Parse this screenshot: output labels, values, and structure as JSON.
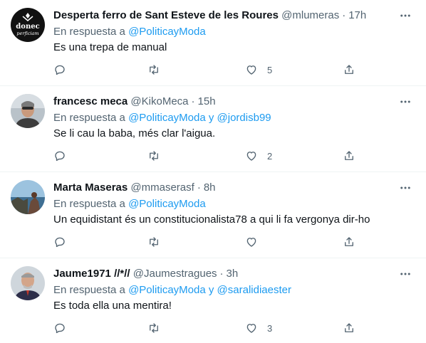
{
  "colors": {
    "text": "#0f1419",
    "secondary": "#536471",
    "link": "#1d9bf0",
    "divider": "#eff3f4"
  },
  "tweets": [
    {
      "name": "Desperta ferro de Sant Esteve de les Roures",
      "handle": "@mlumeras",
      "time": "17h",
      "reply_prefix": "En respuesta a",
      "mention1": "@PoliticayModa",
      "mention_joiner": "",
      "mention2": "",
      "text": "Es una trepa de manual",
      "like_count": "5",
      "avatar": {
        "top_text": "donec",
        "bottom_text": "perficiam"
      }
    },
    {
      "name": "francesc meca",
      "handle": "@KikoMeca",
      "time": "15h",
      "reply_prefix": "En respuesta a",
      "mention1": "@PoliticayModa",
      "mention_joiner": "y",
      "mention2": "@jordisb99",
      "text": "Se li cau la baba, més clar l'aigua.",
      "like_count": "2"
    },
    {
      "name": "Marta Maseras",
      "handle": "@mmaserasf",
      "time": "8h",
      "reply_prefix": "En respuesta a",
      "mention1": "@PoliticayModa",
      "mention_joiner": "",
      "mention2": "",
      "text": "Un equidistant és un constitucionalista78 a qui li fa vergonya dir-ho",
      "like_count": ""
    },
    {
      "name": "Jaume1971 //*//",
      "handle": "@Jaumestragues",
      "time": "3h",
      "reply_prefix": "En respuesta a",
      "mention1": "@PoliticayModa",
      "mention_joiner": "y",
      "mention2": "@saralidiaester",
      "text": "Es toda ella una mentira!",
      "like_count": "3"
    }
  ]
}
